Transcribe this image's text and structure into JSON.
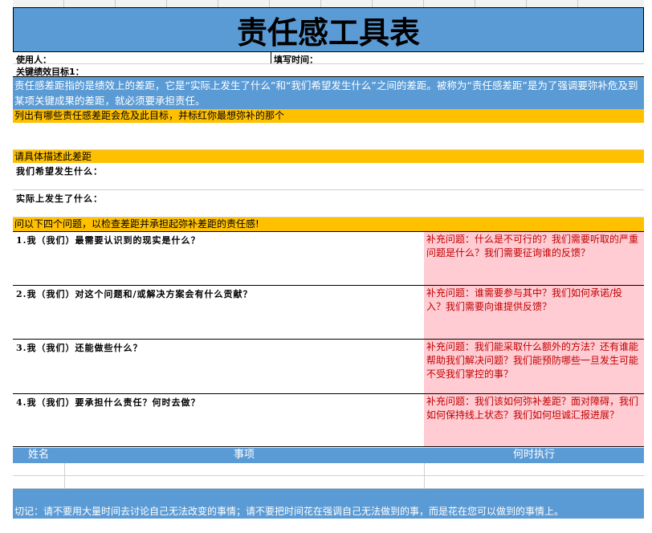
{
  "title": "责任感工具表",
  "user_label": "使用人：",
  "fill_time_label": "填写时间：",
  "key_goal_label": "关键绩效目标1：",
  "intro": "责任感差距指的是绩效上的差距，它是“实际上发生了什么”和“我们希望发生什么”之间的差距。被称为“责任感差距”是为了强调要弥补危及到某项关键成果的差距，就必须要承担责任。",
  "prompt1": "列出有哪些责任感差距会危及此目标，并标红你最想弥补的那个",
  "prompt2": "请具体描述此差距",
  "hope_label": "我们希望发生什么：",
  "actual_label": "实际上发生了什么：",
  "prompt3": "问以下四个问题，以检查差距并承担起弥补差距的责任感!",
  "questions": [
    {
      "q": "1.我（我们）最需要认识到的现实是什么？",
      "hint": "补充问题：什么是不可行的？我们需要听取的严重问题是什么？我们需要征询谁的反馈？"
    },
    {
      "q": "2.我（我们）对这个问题和/或解决方案会有什么贡献？",
      "hint": "补充问题：谁需要参与其中？我们如何承诺/投入？我们需要向谁提供反馈？"
    },
    {
      "q": "3.我（我们）还能做些什么？",
      "hint": "补充问题：我们能采取什么额外的方法？还有谁能帮助我们解决问题？我们能预防哪些一旦发生可能不受我们掌控的事？"
    },
    {
      "q": "4.我（我们）要承担什么责任？何时去做？",
      "hint": "补充问题：我们该如何弥补差距？面对障碍，我们如何保持线上状态？我们如何坦诚汇报进展？"
    }
  ],
  "table_headers": {
    "name": "姓名",
    "item": "事项",
    "when": "何时执行"
  },
  "footer": "切记：请不要用大量时间去讨论自己无法改变的事情；请不要把时间花在强调自己无法做到的事，而是花在您可以做到的事情上。"
}
